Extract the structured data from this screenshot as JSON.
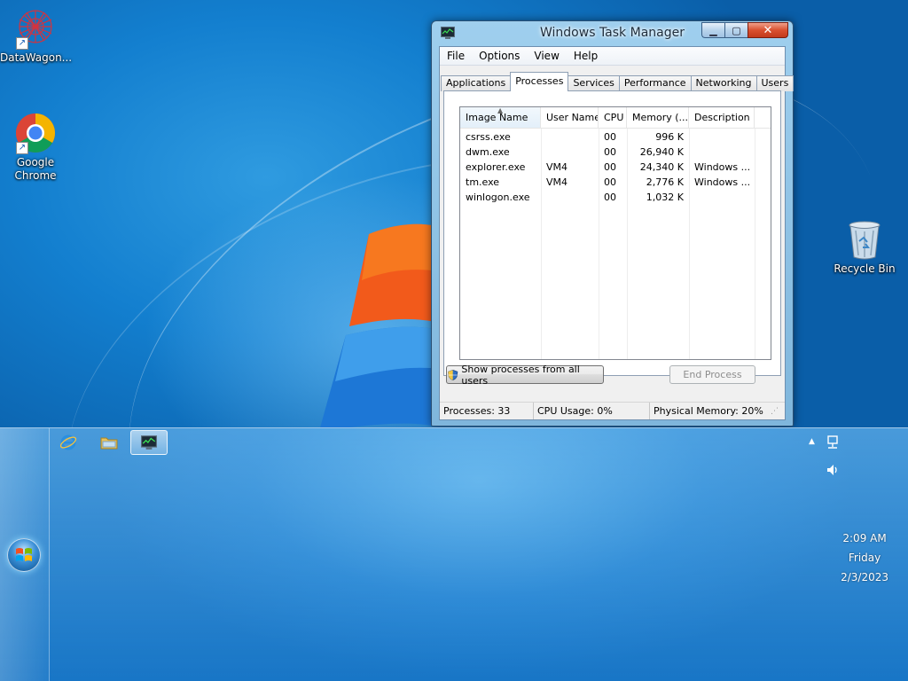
{
  "desktop": {
    "icons": [
      {
        "label": "DataWagon...",
        "icon": "datawagon-icon"
      },
      {
        "label": "Google Chrome",
        "icon": "chrome-icon"
      },
      {
        "label": "Recycle Bin",
        "icon": "recycle-bin-icon"
      }
    ]
  },
  "window": {
    "title": "Windows Task Manager",
    "menu": [
      "File",
      "Options",
      "View",
      "Help"
    ],
    "tabs": [
      "Applications",
      "Processes",
      "Services",
      "Performance",
      "Networking",
      "Users"
    ],
    "active_tab": "Processes",
    "columns": [
      "Image Name",
      "User Name",
      "CPU",
      "Memory (...",
      "Description"
    ],
    "processes": [
      {
        "image": "csrss.exe",
        "user": "",
        "cpu": "00",
        "memory": "996 K",
        "description": ""
      },
      {
        "image": "dwm.exe",
        "user": "",
        "cpu": "00",
        "memory": "26,940 K",
        "description": ""
      },
      {
        "image": "explorer.exe",
        "user": "VM4",
        "cpu": "00",
        "memory": "24,340 K",
        "description": "Windows ..."
      },
      {
        "image": "tm.exe",
        "user": "VM4",
        "cpu": "00",
        "memory": "2,776 K",
        "description": "Windows ..."
      },
      {
        "image": "winlogon.exe",
        "user": "",
        "cpu": "00",
        "memory": "1,032 K",
        "description": ""
      }
    ],
    "show_all_label": "Show processes from all users",
    "end_process_label": "End Process",
    "status": {
      "processes": "Processes: 33",
      "cpu": "CPU Usage: 0%",
      "memory": "Physical Memory: 20%"
    }
  },
  "taskbar": {
    "pinned": [
      "internet-explorer-icon",
      "windows-explorer-icon",
      "task-manager-icon"
    ],
    "clock": {
      "time": "2:09 AM",
      "day": "Friday",
      "date": "2/3/2023"
    }
  },
  "colors": {
    "wallpaper": "#137fcf",
    "titlebar": "#9fcfee",
    "close_button": "#d9502f"
  }
}
